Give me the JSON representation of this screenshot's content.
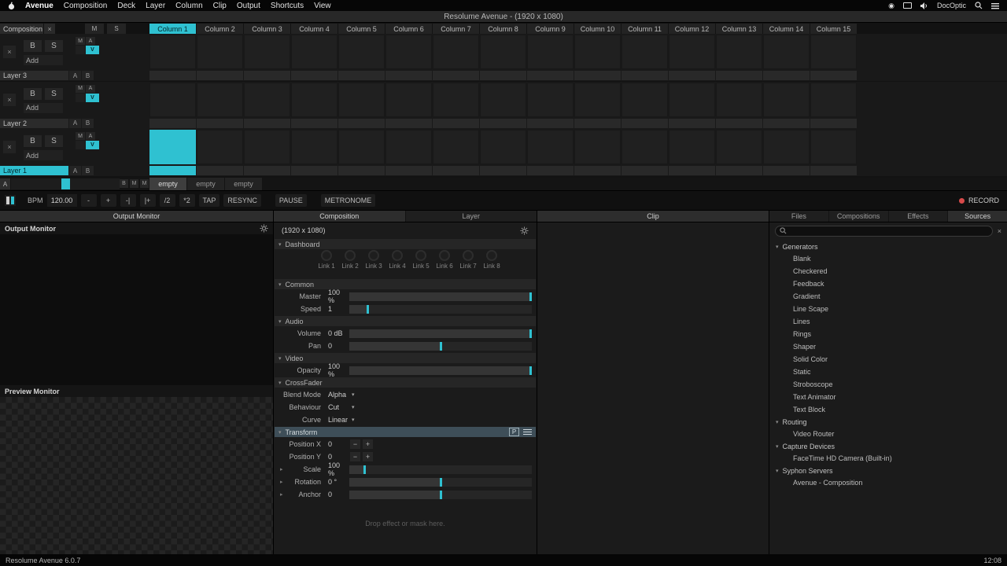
{
  "colors": {
    "accent": "#2fc1d1",
    "record_red": "#d84a4a"
  },
  "menubar": {
    "items": [
      "Avenue",
      "Composition",
      "Deck",
      "Layer",
      "Column",
      "Clip",
      "Output",
      "Shortcuts",
      "View"
    ],
    "status_text": "DocOptic"
  },
  "titlebar": {
    "title": "Resolume Avenue -  (1920 x 1080)"
  },
  "grid": {
    "composition": {
      "label": "Composition",
      "close": "×",
      "m": "M",
      "s": "S"
    },
    "columns": [
      {
        "label": "Column 1",
        "selected": true
      },
      {
        "label": "Column 2"
      },
      {
        "label": "Column 3"
      },
      {
        "label": "Column 4"
      },
      {
        "label": "Column 5"
      },
      {
        "label": "Column 6"
      },
      {
        "label": "Column 7"
      },
      {
        "label": "Column 8"
      },
      {
        "label": "Column 9"
      },
      {
        "label": "Column 10"
      },
      {
        "label": "Column 11"
      },
      {
        "label": "Column 12"
      },
      {
        "label": "Column 13"
      },
      {
        "label": "Column 14"
      },
      {
        "label": "Column 15"
      }
    ],
    "layers": [
      {
        "name": "Layer 3",
        "selected": false,
        "playing_column": -1
      },
      {
        "name": "Layer 2",
        "selected": false,
        "playing_column": -1
      },
      {
        "name": "Layer 1",
        "selected": true,
        "playing_column": 0
      }
    ],
    "layer_controls": {
      "close": "×",
      "b": "B",
      "s": "S",
      "add": "Add",
      "m": "M",
      "a": "A",
      "v": "V",
      "cross_a": "A",
      "cross_b": "B"
    },
    "crossfader": {
      "a_label": "A",
      "buttons": [
        "B",
        "M",
        "M"
      ],
      "deck_tabs": [
        {
          "label": "empty",
          "active": true
        },
        {
          "label": "empty",
          "active": false
        },
        {
          "label": "empty",
          "active": false
        }
      ]
    }
  },
  "transport": {
    "bpm_label": "BPM",
    "bpm_value": "120.00",
    "buttons": [
      "-",
      "+",
      "-|",
      "|+",
      "/2",
      "*2",
      "TAP",
      "RESYNC"
    ],
    "pause": "PAUSE",
    "metronome": "METRONOME",
    "record": "RECORD"
  },
  "monitors": {
    "tab": "Output Monitor",
    "output_title": "Output Monitor",
    "preview_title": "Preview Monitor"
  },
  "props": {
    "tabs": [
      {
        "label": "Composition",
        "active": true
      },
      {
        "label": "Layer",
        "active": false
      }
    ],
    "size": "(1920 x 1080)",
    "dashboard": {
      "title": "Dashboard",
      "links": [
        "Link 1",
        "Link 2",
        "Link 3",
        "Link 4",
        "Link 5",
        "Link 6",
        "Link 7",
        "Link 8"
      ]
    },
    "sections": [
      {
        "title": "Common",
        "rows": [
          {
            "label": "Master",
            "value": "100 %",
            "slider": 1
          },
          {
            "label": "Speed",
            "value": "1",
            "slider": 0.1
          }
        ]
      },
      {
        "title": "Audio",
        "rows": [
          {
            "label": "Volume",
            "value": "0 dB",
            "slider": 1
          },
          {
            "label": "Pan",
            "value": "0",
            "slider": 0.5
          }
        ]
      },
      {
        "title": "Video",
        "rows": [
          {
            "label": "Opacity",
            "value": "100 %",
            "slider": 1
          }
        ]
      },
      {
        "title": "CrossFader",
        "rows": [
          {
            "label": "Blend Mode",
            "value": "Alpha",
            "dropdown": true
          },
          {
            "label": "Behaviour",
            "value": "Cut",
            "dropdown": true
          },
          {
            "label": "Curve",
            "value": "Linear",
            "dropdown": true
          }
        ]
      },
      {
        "title": "Transform",
        "highlight": true,
        "icons": true,
        "p_button": "P",
        "rows": [
          {
            "label": "Position X",
            "value": "0",
            "stepper": true
          },
          {
            "label": "Position Y",
            "value": "0",
            "stepper": true
          },
          {
            "label": "Scale",
            "value": "100 %",
            "slider": 0.08,
            "expand": true
          },
          {
            "label": "Rotation",
            "value": "0 °",
            "slider": 0.5,
            "expand": true
          },
          {
            "label": "Anchor",
            "value": "0",
            "slider": 0.5,
            "expand": true
          }
        ]
      }
    ],
    "drop_hint": "Drop effect or mask here."
  },
  "clip_panel": {
    "tab": "Clip"
  },
  "browser": {
    "tabs": [
      {
        "label": "Files",
        "active": false
      },
      {
        "label": "Compositions",
        "active": false
      },
      {
        "label": "Effects",
        "active": false
      },
      {
        "label": "Sources",
        "active": true
      }
    ],
    "search": {
      "placeholder": "",
      "close": "×"
    },
    "tree": [
      {
        "label": "Generators",
        "children": [
          "Blank",
          "Checkered",
          "Feedback",
          "Gradient",
          "Line Scape",
          "Lines",
          "Rings",
          "Shaper",
          "Solid Color",
          "Static",
          "Stroboscope",
          "Text Animator",
          "Text Block"
        ]
      },
      {
        "label": "Routing",
        "children": [
          "Video Router"
        ]
      },
      {
        "label": "Capture Devices",
        "children": [
          "FaceTime HD Camera (Built-in)"
        ]
      },
      {
        "label": "Syphon Servers",
        "children": [
          "Avenue - Composition"
        ]
      }
    ]
  },
  "statusbar": {
    "left": "Resolume Avenue 6.0.7",
    "right": "12:08"
  }
}
